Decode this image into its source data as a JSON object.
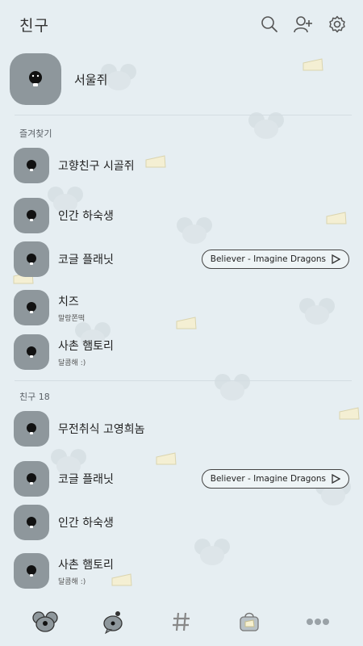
{
  "header": {
    "title": "친구",
    "icons": [
      "search-icon",
      "add-friend-icon",
      "settings-icon"
    ]
  },
  "profile": {
    "name": "서울쥐"
  },
  "favorites": {
    "label": "즐겨찾기",
    "items": [
      {
        "name": "고향친구 시골쥐",
        "status": ""
      },
      {
        "name": "인간 하숙생",
        "status": ""
      },
      {
        "name": "코글 플래닛",
        "status": "",
        "music": "Believer - Imagine Dragons"
      },
      {
        "name": "치즈",
        "status": "말랑쫀떡"
      },
      {
        "name": "사촌 햄토리",
        "status": "달콤해 :)"
      }
    ]
  },
  "friends": {
    "label": "친구 18",
    "items": [
      {
        "name": "무전취식 고영희놈",
        "status": ""
      },
      {
        "name": "코글 플래닛",
        "status": "",
        "music": "Believer - Imagine Dragons"
      },
      {
        "name": "인간 하숙생",
        "status": ""
      },
      {
        "name": "사촌 햄토리",
        "status": "달콤해 :)"
      }
    ]
  },
  "nav": {
    "items": [
      "friends-tab-icon",
      "chat-tab-icon",
      "hashtag-tab-icon",
      "shop-tab-icon",
      "more-tab-icon"
    ]
  },
  "colors": {
    "background": "#e6eef2",
    "avatar": "#8e979c",
    "divider": "#d4dde2",
    "cheese": "#f6f0d0"
  }
}
